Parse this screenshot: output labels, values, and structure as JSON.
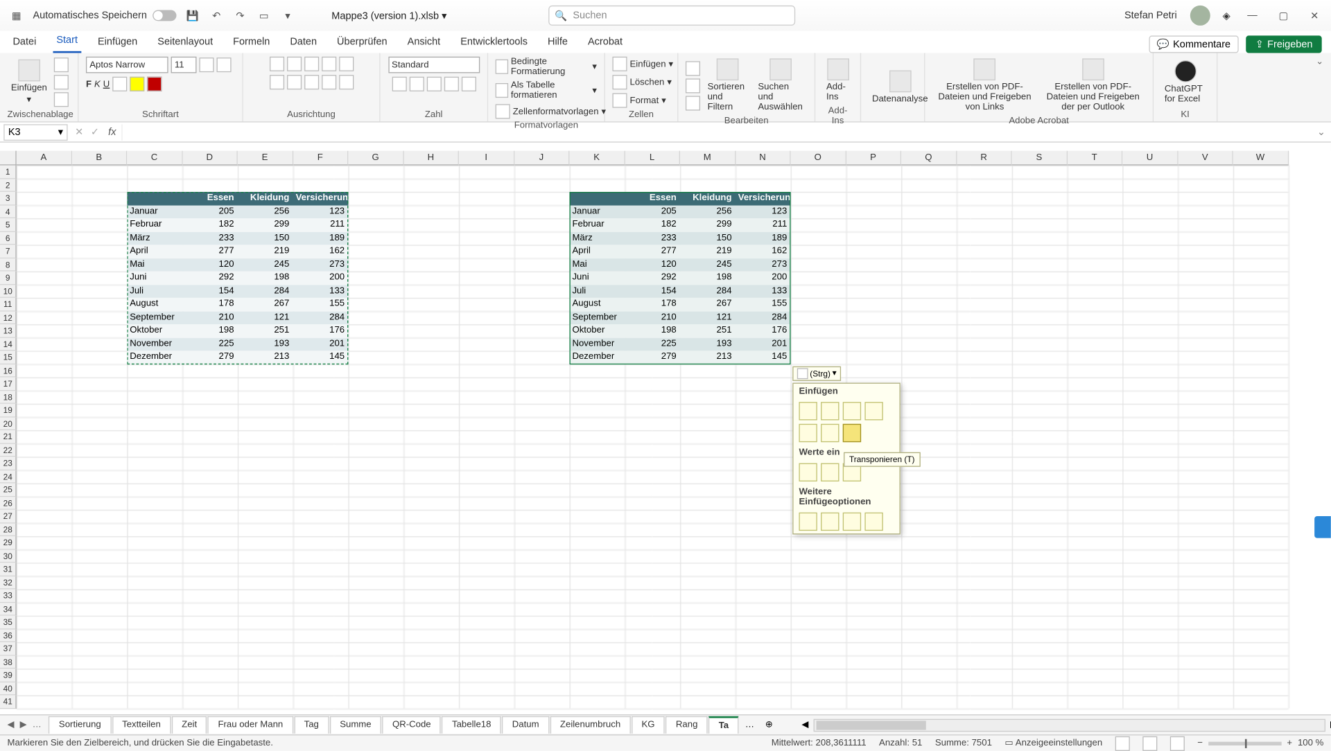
{
  "title": {
    "autosave": "Automatisches Speichern",
    "filename": "Mappe3 (version 1).xlsb",
    "search_placeholder": "Suchen",
    "username": "Stefan Petri"
  },
  "menu": {
    "items": [
      "Datei",
      "Start",
      "Einfügen",
      "Seitenlayout",
      "Formeln",
      "Daten",
      "Überprüfen",
      "Ansicht",
      "Entwicklertools",
      "Hilfe",
      "Acrobat"
    ],
    "active": "Start",
    "kommentare": "Kommentare",
    "freigeben": "Freigeben"
  },
  "ribbon": {
    "groups": [
      "Zwischenablage",
      "Schriftart",
      "Ausrichtung",
      "Zahl",
      "Formatvorlagen",
      "Zellen",
      "Bearbeiten",
      "Add-Ins",
      "Adobe Acrobat",
      "KI"
    ],
    "einfuegen": "Einfügen",
    "font_name": "Aptos Narrow",
    "font_size": "11",
    "num_format": "Standard",
    "bedingte": "Bedingte Formatierung",
    "alsTabelle": "Als Tabelle formatieren",
    "zellfmt": "Zellenformatvorlagen",
    "cell_einf": "Einfügen",
    "cell_del": "Löschen",
    "cell_fmt": "Format",
    "sortfilter": "Sortieren und Filtern",
    "suchen": "Suchen und Auswählen",
    "addins": "Add-Ins",
    "datenanalyse": "Datenanalyse",
    "acro1": "Erstellen von PDF-Dateien und Freigeben von Links",
    "acro2": "Erstellen von PDF-Dateien und Freigeben der per Outlook",
    "chatgpt": "ChatGPT for Excel"
  },
  "fbar": {
    "namebox": "K3"
  },
  "columns": [
    "A",
    "B",
    "C",
    "D",
    "E",
    "F",
    "G",
    "H",
    "I",
    "J",
    "K",
    "L",
    "M",
    "N",
    "O",
    "P",
    "Q",
    "R",
    "S",
    "T",
    "U",
    "V",
    "W"
  ],
  "colwidth": 60.5,
  "rows": 41,
  "table": {
    "headers": [
      "",
      "Essen",
      "Kleidung",
      "Versicherung"
    ],
    "rows": [
      [
        "Januar",
        205,
        256,
        123
      ],
      [
        "Februar",
        182,
        299,
        211
      ],
      [
        "März",
        233,
        150,
        189
      ],
      [
        "April",
        277,
        219,
        162
      ],
      [
        "Mai",
        120,
        245,
        273
      ],
      [
        "Juni",
        292,
        198,
        200
      ],
      [
        "Juli",
        154,
        284,
        133
      ],
      [
        "August",
        178,
        267,
        155
      ],
      [
        "September",
        210,
        121,
        284
      ],
      [
        "Oktober",
        198,
        251,
        176
      ],
      [
        "November",
        225,
        193,
        201
      ],
      [
        "Dezember",
        279,
        213,
        145
      ]
    ],
    "header2_last": "Versicherun"
  },
  "paste": {
    "strg": "(Strg)",
    "sec1": "Einfügen",
    "sec2": "Werte ein",
    "sec3": "Weitere Einfügeoptionen",
    "tooltip": "Transponieren (T)"
  },
  "tabs": [
    "Sortierung",
    "Textteilen",
    "Zeit",
    "Frau oder Mann",
    "Tag",
    "Summe",
    "QR-Code",
    "Tabelle18",
    "Datum",
    "Zeilenumbruch",
    "KG",
    "Rang",
    "Ta"
  ],
  "status": {
    "msg": "Markieren Sie den Zielbereich, und drücken Sie die Eingabetaste.",
    "mittel_l": "Mittelwert:",
    "mittel_v": "208,3611111",
    "anz_l": "Anzahl:",
    "anz_v": "51",
    "sum_l": "Summe:",
    "sum_v": "7501",
    "anzeige": "Anzeigeeinstellungen",
    "zoom": "100 %"
  }
}
